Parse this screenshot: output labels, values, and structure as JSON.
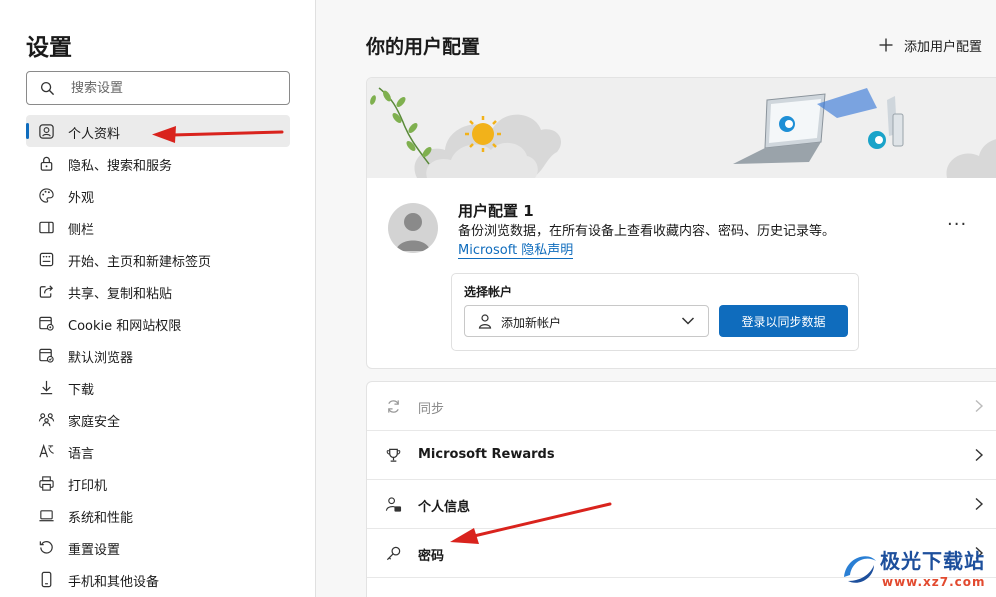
{
  "sidebar": {
    "title": "设置",
    "search_placeholder": "搜索设置",
    "items": [
      {
        "label": "个人资料",
        "icon": "profile-icon",
        "active": true
      },
      {
        "label": "隐私、搜索和服务",
        "icon": "lock-icon"
      },
      {
        "label": "外观",
        "icon": "palette-icon"
      },
      {
        "label": "侧栏",
        "icon": "sidebar-icon"
      },
      {
        "label": "开始、主页和新建标签页",
        "icon": "home-icon"
      },
      {
        "label": "共享、复制和粘贴",
        "icon": "share-icon"
      },
      {
        "label": "Cookie 和网站权限",
        "icon": "site-permissions-icon"
      },
      {
        "label": "默认浏览器",
        "icon": "browser-icon"
      },
      {
        "label": "下载",
        "icon": "download-icon"
      },
      {
        "label": "家庭安全",
        "icon": "family-icon"
      },
      {
        "label": "语言",
        "icon": "language-icon"
      },
      {
        "label": "打印机",
        "icon": "printer-icon"
      },
      {
        "label": "系统和性能",
        "icon": "laptop-icon"
      },
      {
        "label": "重置设置",
        "icon": "reset-icon"
      },
      {
        "label": "手机和其他设备",
        "icon": "phone-icon"
      }
    ]
  },
  "main": {
    "title": "你的用户配置",
    "add_profile_label": "添加用户配置",
    "profile": {
      "name": "用户配置 1",
      "description": "备份浏览数据，在所有设备上查看收藏内容、密码、历史记录等。",
      "privacy_link": "Microsoft 隐私声明",
      "more": "···",
      "account_label": "选择帐户",
      "account_value": "添加新帐户",
      "signin_button": "登录以同步数据"
    },
    "rows": [
      {
        "label": "同步",
        "icon": "sync-icon",
        "disabled": true
      },
      {
        "label": "Microsoft Rewards",
        "icon": "trophy-icon"
      },
      {
        "label": "个人信息",
        "icon": "person-card-icon"
      },
      {
        "label": "密码",
        "icon": "key-icon"
      }
    ]
  },
  "watermark": {
    "text": "极光下载站",
    "url": "www.xz7.com"
  },
  "colors": {
    "accent": "#0f6cbd",
    "arrow": "#d9231d"
  }
}
